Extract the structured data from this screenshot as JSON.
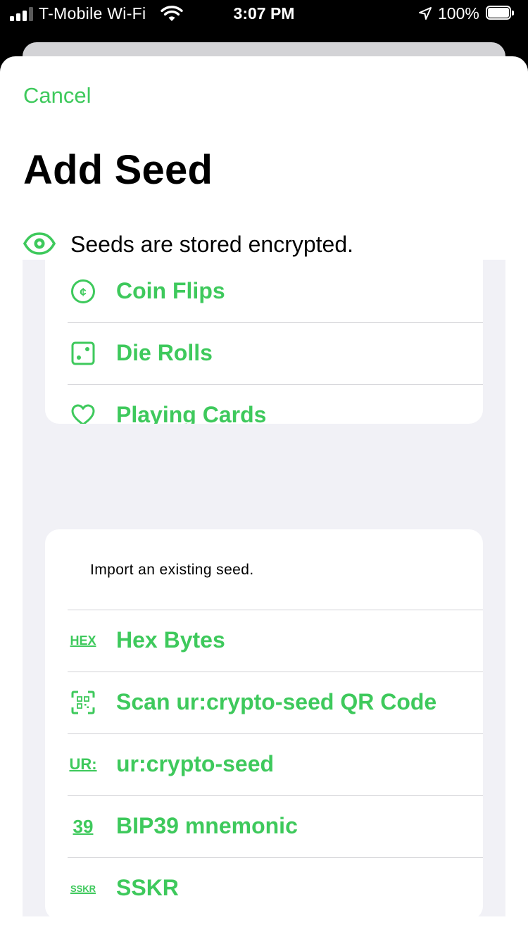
{
  "status_bar": {
    "carrier": "T-Mobile Wi-Fi",
    "time": "3:07 PM",
    "battery": "100%",
    "battery_level": 1.0,
    "signal_bars": 3,
    "signal_bars_total": 4
  },
  "sheet": {
    "cancel_label": "Cancel",
    "title": "Add Seed",
    "note_icon": "eye-icon",
    "note": "Seeds are stored encrypted."
  },
  "generate_section": {
    "items": [
      {
        "label": "Coin Flips",
        "icon": "coin-icon"
      },
      {
        "label": "Die Rolls",
        "icon": "die-icon"
      },
      {
        "label": "Playing Cards",
        "icon": "heart-icon"
      }
    ]
  },
  "import_section": {
    "caption": "Import an existing seed.",
    "items": [
      {
        "label": "Hex Bytes",
        "icon": "hex-icon",
        "icon_text": "HEX"
      },
      {
        "label": "Scan ur:crypto-seed QR Code",
        "icon": "qr-scan-icon"
      },
      {
        "label": "ur:crypto-seed",
        "icon": "ur-icon",
        "icon_text": "UR:"
      },
      {
        "label": "BIP39 mnemonic",
        "icon": "bip39-icon",
        "icon_text": "39"
      },
      {
        "label": "SSKR",
        "icon": "sskr-icon",
        "icon_text": "SSKR"
      }
    ]
  },
  "colors": {
    "accent": "#3ec95c",
    "grouped_background": "#f1f1f6",
    "separator": "#d2d2d6"
  }
}
